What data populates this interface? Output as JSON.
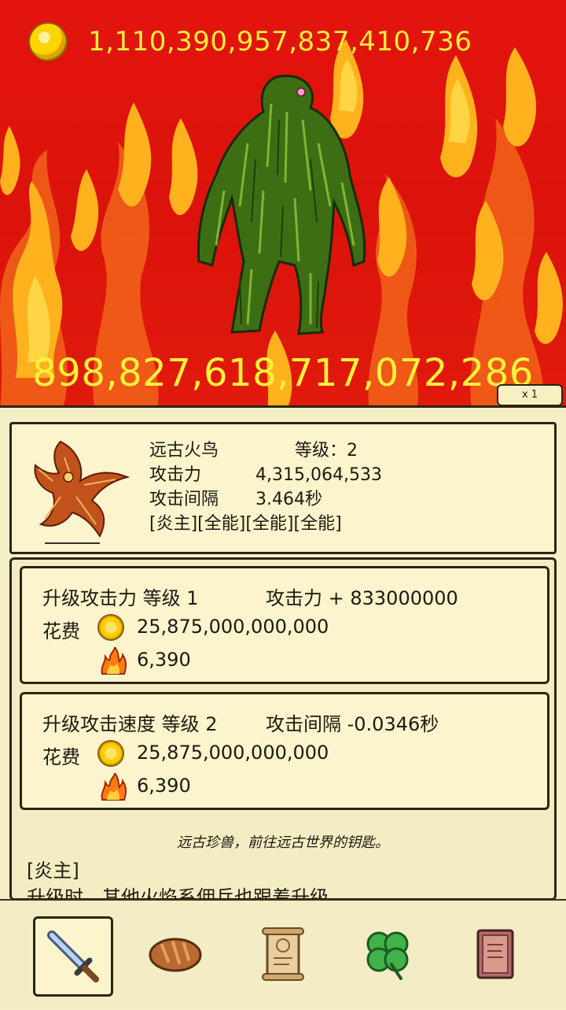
{
  "hud": {
    "gold": "1,110,390,957,837,410,736",
    "monster_hp": "898,827,618,717,072,286",
    "multiplier": "x 1"
  },
  "unit": {
    "name": "远古火鸟",
    "level": "等级：2",
    "attack_label": "攻击力",
    "attack_value": "4,315,064,533",
    "interval_label": "攻击间隔",
    "interval_value": "3.464秒",
    "tags": "[炎主][全能][全能][全能]"
  },
  "upgrades": [
    {
      "title": "升级攻击力 等级 1",
      "effect": "攻击力 + 833000000",
      "cost_label": "花费",
      "gold_cost": "25,875,000,000,000",
      "fire_cost": "6,390"
    },
    {
      "title": "升级攻击速度 等级 2",
      "effect": "攻击间隔 -0.0346秒",
      "cost_label": "花费",
      "gold_cost": "25,875,000,000,000",
      "fire_cost": "6,390"
    }
  ],
  "description": "远古珍兽，前往远古世界的钥匙。",
  "trait": {
    "name": "[炎主]",
    "text": "升级时，其他火焰系佣兵也跟着升级。"
  },
  "tabs": [
    {
      "icon": "sword-icon",
      "active": true
    },
    {
      "icon": "bread-icon",
      "active": false
    },
    {
      "icon": "scroll-icon",
      "active": false
    },
    {
      "icon": "clover-icon",
      "active": false
    },
    {
      "icon": "book-icon",
      "active": false
    }
  ],
  "colors": {
    "background_red": "#e3140e",
    "number_yellow": "#fff23a",
    "panel_cream": "#f5efc6",
    "border_dark": "#2c2414"
  }
}
